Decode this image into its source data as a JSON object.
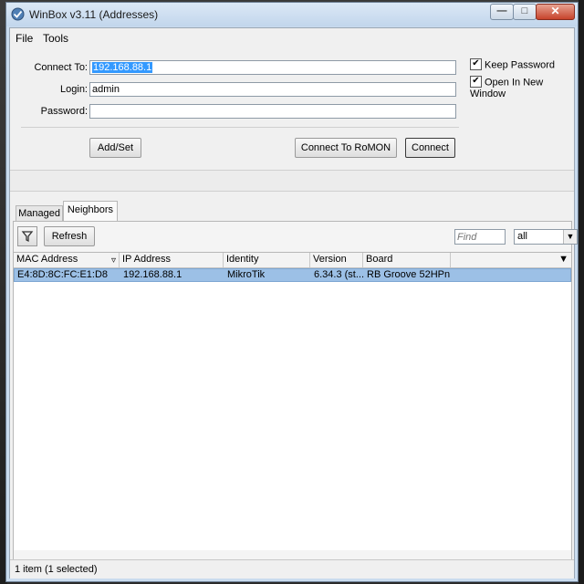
{
  "window": {
    "title": "WinBox v3.11 (Addresses)",
    "controls": {
      "minimize": "—",
      "maximize": "□",
      "close": "✕"
    }
  },
  "menu": {
    "file": "File",
    "tools": "Tools"
  },
  "login_form": {
    "connect_to_label": "Connect To:",
    "connect_to_value": "192.168.88.1",
    "login_label": "Login:",
    "login_value": "admin",
    "password_label": "Password:",
    "password_value": "",
    "keep_password_label": "Keep Password",
    "keep_password_checked": true,
    "open_new_window_label": "Open In New Window",
    "open_new_window_checked": true,
    "add_set_button": "Add/Set",
    "connect_romon_button": "Connect To RoMON",
    "connect_button": "Connect"
  },
  "tabs": {
    "managed": "Managed",
    "neighbors": "Neighbors",
    "active": "Neighbors"
  },
  "toolbar": {
    "filter_icon": "filter-funnel-icon",
    "refresh_button": "Refresh",
    "find_placeholder": "Find",
    "scope_select_value": "all"
  },
  "table": {
    "columns": [
      "MAC Address",
      "IP Address",
      "Identity",
      "Version",
      "Board"
    ],
    "rows": [
      {
        "mac": "E4:8D:8C:FC:E1:D8",
        "ip": "192.168.88.1",
        "identity": "MikroTik",
        "version": "6.34.3 (st...",
        "board": "RB Groove 52HPn",
        "selected": true
      }
    ]
  },
  "status": {
    "text": "1 item (1 selected)"
  },
  "colors": {
    "titlebar": "#c9dbee",
    "selection": "#9cc0e6",
    "text_selection": "#3399ff",
    "close_button": "#c7432b"
  }
}
